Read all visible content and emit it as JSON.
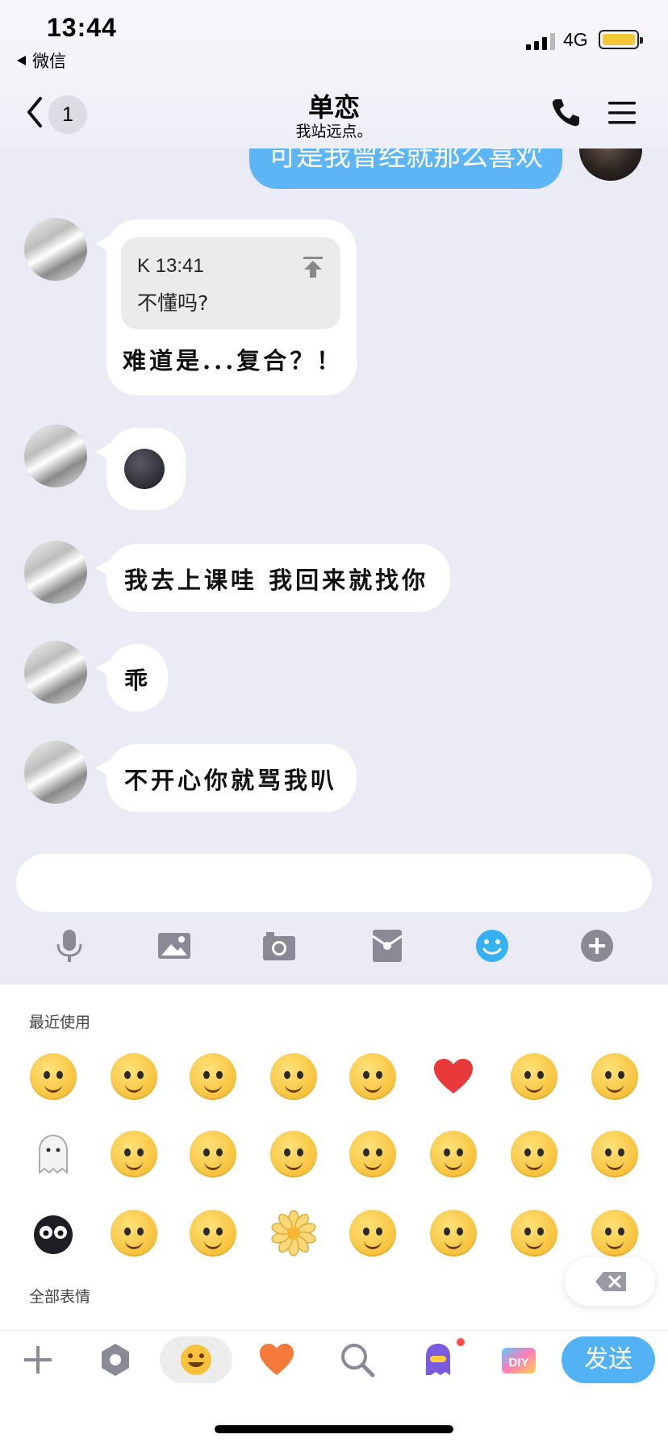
{
  "status": {
    "time": "13:44",
    "back_app": "微信",
    "network": "4G"
  },
  "nav": {
    "unread_count": "1",
    "title": "单恋",
    "subtitle": "我站远点。"
  },
  "outgoing_message": "可是我曾经就那么喜欢",
  "quote": {
    "sender_time": "K 13:41",
    "text": "不懂吗?"
  },
  "messages": [
    {
      "text": "难道是...复合？！"
    },
    {
      "text": "🌑"
    },
    {
      "text": "我去上课哇 我回来就找你"
    },
    {
      "text": "乖"
    },
    {
      "text": "不开心你就骂我叭"
    }
  ],
  "emoji_panel": {
    "recent_label": "最近使用",
    "all_label": "全部表情"
  },
  "send_label": "发送",
  "bottom_tabs": [
    "add-icon",
    "hexagon-icon",
    "smiley-icon",
    "heart-icon",
    "search-icon",
    "ghost-icon",
    "diy-icon"
  ],
  "toolbar_icons": [
    "microphone-icon",
    "image-icon",
    "camera-icon",
    "red-packet-icon",
    "emoji-icon",
    "plus-circle-icon"
  ],
  "colors": {
    "accent": "#52b2f3",
    "background": "#ebebf5",
    "bubble": "#ffffff"
  }
}
